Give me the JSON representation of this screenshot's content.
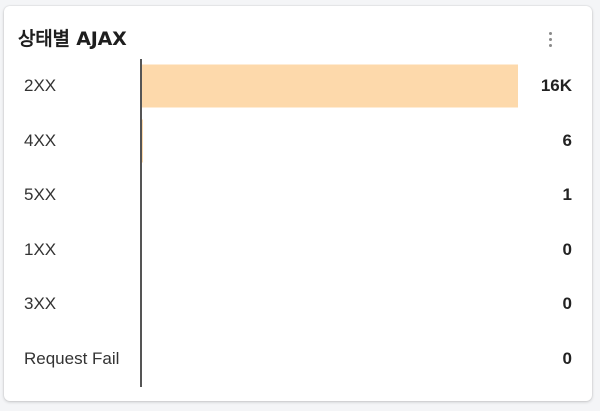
{
  "widget": {
    "title": "상태별 AJAX",
    "menu_icon": "more-vertical-icon",
    "bar_color": "#fdd9ab"
  },
  "chart_data": {
    "type": "bar",
    "orientation": "horizontal",
    "categories": [
      "2XX",
      "4XX",
      "5XX",
      "1XX",
      "3XX",
      "Request Fail"
    ],
    "values": [
      16000,
      6,
      1,
      0,
      0,
      0
    ],
    "value_labels": [
      "16K",
      "6",
      "1",
      "0",
      "0",
      "0"
    ]
  }
}
